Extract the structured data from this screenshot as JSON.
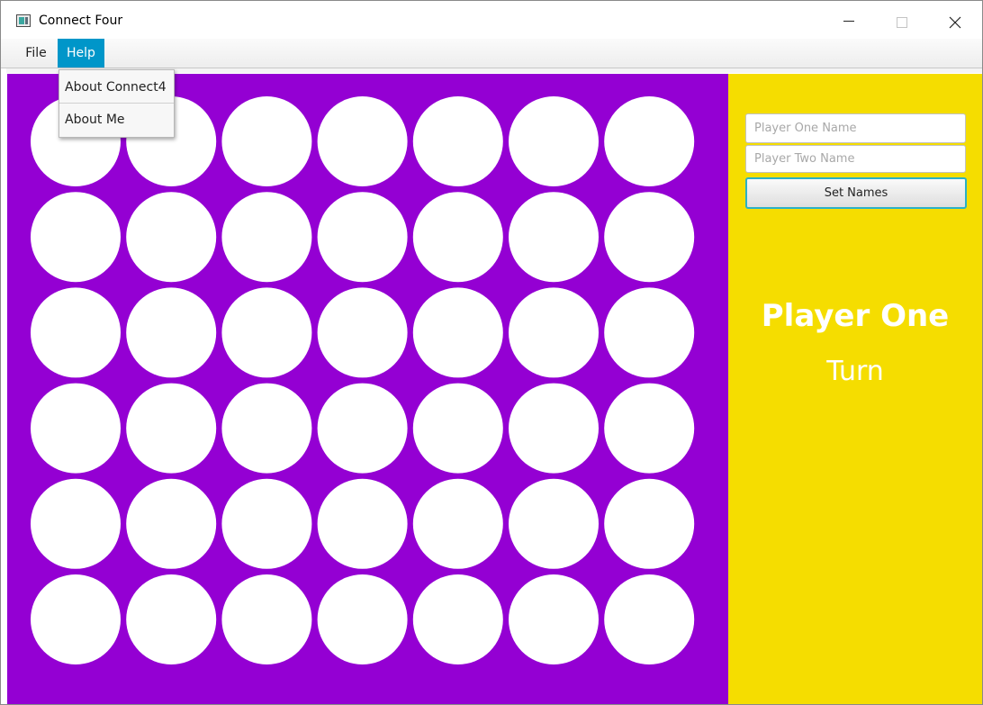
{
  "window": {
    "title": "Connect Four",
    "app_icon": "window-app-icon",
    "controls": [
      "minimize-icon",
      "maximize-icon",
      "close-icon"
    ]
  },
  "menubar": {
    "file_label": "File",
    "help_label": "Help",
    "help_active": true
  },
  "help_menu": {
    "items": [
      {
        "label": "About Connect4"
      },
      {
        "label": "About Me"
      }
    ]
  },
  "board": {
    "rows": 6,
    "columns": 7,
    "cells": "all-empty",
    "colors": {
      "board": "#9400d3",
      "empty_slot": "#ffffff"
    }
  },
  "side_panel": {
    "color": "#f5dd00",
    "player_one_field": {
      "value": "",
      "placeholder": "Player One Name"
    },
    "player_two_field": {
      "value": "",
      "placeholder": "Player Two Name"
    },
    "set_names_label": "Set Names",
    "current_player": "Player One",
    "turn_label": "Turn"
  },
  "colors": {
    "menu_highlight": "#0096c9",
    "button_focus_border": "#2bb1c6"
  }
}
